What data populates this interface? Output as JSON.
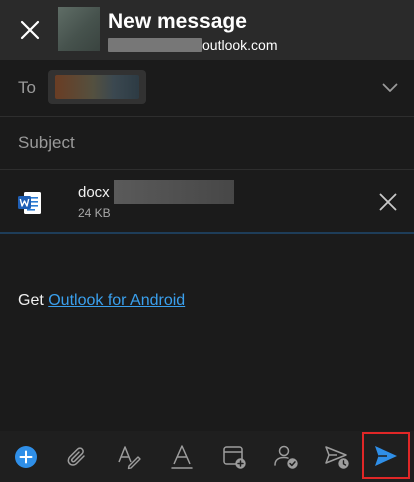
{
  "header": {
    "title": "New message",
    "account_suffix": "outlook.com"
  },
  "to": {
    "label": "To"
  },
  "subject": {
    "placeholder": "Subject"
  },
  "attachment": {
    "name_visible": "docx",
    "size": "24 KB",
    "file_type_icon": "word-document-icon"
  },
  "signature": {
    "prefix": "Get ",
    "link_text": "Outlook for Android"
  },
  "colors": {
    "accent": "#3aa0ee",
    "send_highlight_border": "#e02727",
    "background": "#1b1b1b"
  },
  "toolbar": {
    "icons": [
      "add-icon",
      "attach-paperclip-icon",
      "format-pen-icon",
      "text-format-icon",
      "calendar-add-icon",
      "availability-person-icon",
      "schedule-send-icon",
      "send-icon"
    ]
  }
}
